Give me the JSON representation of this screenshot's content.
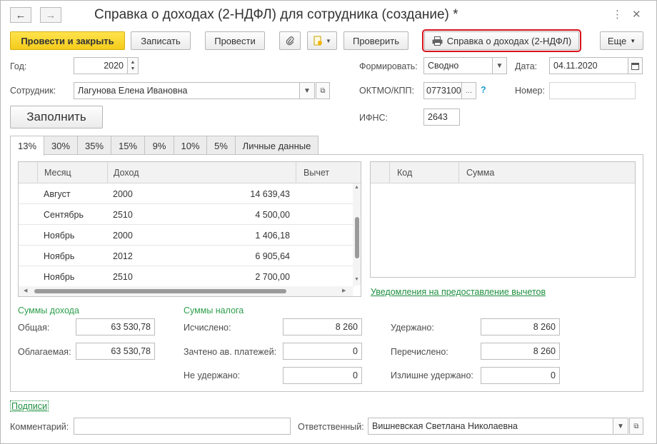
{
  "window": {
    "title": "Справка о доходах (2-НДФЛ) для сотрудника (создание) *"
  },
  "toolbar": {
    "post_close": "Провести и закрыть",
    "save": "Записать",
    "post": "Провести",
    "check": "Проверить",
    "print_report": "Справка о доходах (2-НДФЛ)",
    "more": "Еще"
  },
  "form": {
    "year_label": "Год:",
    "year_value": "2020",
    "employee_label": "Сотрудник:",
    "employee_value": "Лагунова Елена Ивановна",
    "fill_button": "Заполнить",
    "generate_label": "Формировать:",
    "generate_value": "Сводно",
    "date_label": "Дата:",
    "date_value": "04.11.2020",
    "oktmo_label": "ОКТМО/КПП:",
    "oktmo_value": "0773100",
    "oktmo_help": "?",
    "number_label": "Номер:",
    "number_value": "",
    "ifns_label": "ИФНС:",
    "ifns_value": "2643"
  },
  "tabs": [
    "13%",
    "30%",
    "35%",
    "15%",
    "9%",
    "10%",
    "5%",
    "Личные данные"
  ],
  "income_table": {
    "columns": [
      "Месяц",
      "Доход",
      "Вычет"
    ],
    "rows": [
      {
        "month": "Август",
        "code": "2000",
        "amount": "14 639,43"
      },
      {
        "month": "Сентябрь",
        "code": "2510",
        "amount": "4 500,00"
      },
      {
        "month": "Ноябрь",
        "code": "2000",
        "amount": "1 406,18"
      },
      {
        "month": "Ноябрь",
        "code": "2012",
        "amount": "6 905,64"
      },
      {
        "month": "Ноябрь",
        "code": "2510",
        "amount": "2 700,00"
      }
    ]
  },
  "deductions_table": {
    "columns": [
      "Код",
      "Сумма"
    ]
  },
  "deductions_link": "Уведомления на предоставление вычетов",
  "income_sums": {
    "header": "Суммы дохода",
    "total_label": "Общая:",
    "total_value": "63 530,78",
    "taxable_label": "Облагаемая:",
    "taxable_value": "63 530,78"
  },
  "tax_sums": {
    "header": "Суммы налога",
    "calculated_label": "Исчислено:",
    "calculated_value": "8 260",
    "advance_label": "Зачтено ав. платежей:",
    "advance_value": "0",
    "not_withheld_label": "Не удержано:",
    "not_withheld_value": "0",
    "withheld_label": "Удержано:",
    "withheld_value": "8 260",
    "transferred_label": "Перечислено:",
    "transferred_value": "8 260",
    "excess_label": "Излишне удержано:",
    "excess_value": "0"
  },
  "footer": {
    "signatures_link": "Подписи",
    "comment_label": "Комментарий:",
    "comment_value": "",
    "responsible_label": "Ответственный:",
    "responsible_value": "Вишневская Светлана Николаевна"
  },
  "colors": {
    "primary_button": "#f4cc1b",
    "highlight_border": "#d6131a",
    "green_text": "#2e9e4e"
  }
}
